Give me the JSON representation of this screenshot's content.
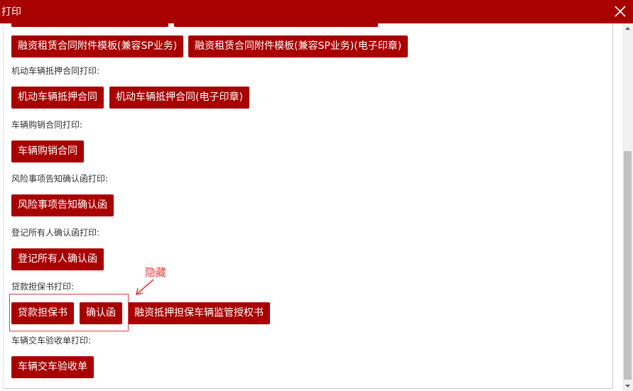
{
  "window": {
    "title": "打印",
    "close_icon": "close-x-icon"
  },
  "sections": {
    "top_clipped_buttons": [
      "",
      ""
    ],
    "lease_attachments": {
      "buttons": [
        "融资租赁合同附件模板(兼容SP业务)",
        "融资租赁合同附件模板(兼容SP业务)(电子印章)"
      ]
    },
    "mortgage": {
      "label": "机动车辆抵押合同打印:",
      "buttons": [
        "机动车辆抵押合同",
        "机动车辆抵押合同(电子印章)"
      ]
    },
    "purchase": {
      "label": "车辆购销合同打印:",
      "buttons": [
        "车辆购销合同"
      ]
    },
    "risk": {
      "label": "风险事项告知确认函打印:",
      "buttons": [
        "风险事项告知确认函"
      ]
    },
    "owner": {
      "label": "登记所有人确认函打印:",
      "buttons": [
        "登记所有人确认函"
      ]
    },
    "loan_guarantee": {
      "label": "贷款担保书打印:",
      "buttons": [
        "贷款担保书",
        "确认函",
        "融资抵押担保车辆监管授权书"
      ]
    },
    "handover": {
      "label": "车辆交车验收单打印:",
      "buttons": [
        "车辆交车验收单"
      ]
    }
  },
  "annotation": {
    "text": "隐藏",
    "color": "#e23d3d"
  },
  "colors": {
    "titlebar": "#a90000",
    "button": "#a90000",
    "button_text": "#ffffff"
  }
}
